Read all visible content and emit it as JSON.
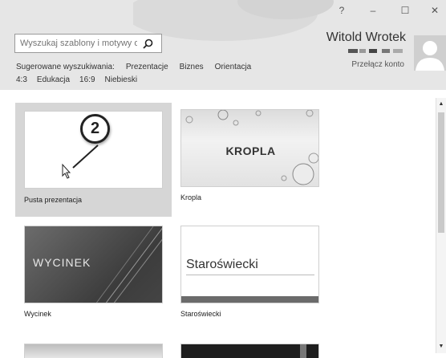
{
  "window": {
    "help": "?",
    "minimize": "–",
    "maximize": "☐",
    "close": "✕"
  },
  "search": {
    "placeholder": "Wyszukaj szablony i motywy o",
    "icon": "search-icon"
  },
  "suggested": {
    "label": "Sugerowane wyszukiwania:",
    "items": [
      "Prezentacje",
      "Biznes",
      "Orientacja",
      "4:3",
      "Edukacja",
      "16:9",
      "Niebieski"
    ]
  },
  "user": {
    "name": "Witold Wrotek",
    "switch": "Przełącz konto",
    "avatar_icon": "person-icon"
  },
  "templates": [
    {
      "name": "Pusta prezentacja",
      "thumb_title": ""
    },
    {
      "name": "Kropla",
      "thumb_title": "KROPLA"
    },
    {
      "name": "Wycinek",
      "thumb_title": "WYCINEK"
    },
    {
      "name": "Staroświecki",
      "thumb_title": "Staroświecki"
    }
  ],
  "callout": {
    "number": "2"
  },
  "colors": {
    "header_bg": "#e6e6e6",
    "selected_tile": "#d6d6d6",
    "wycinek_bg": "#4a4a4a",
    "staroswiecki_bar": "#6b6b6b"
  }
}
